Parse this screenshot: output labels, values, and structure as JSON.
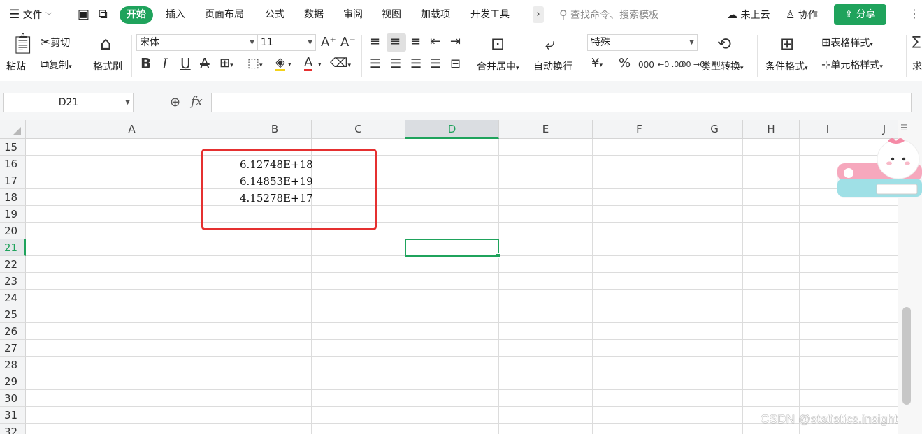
{
  "menubar": {
    "file_menu": "文件",
    "tabs": [
      {
        "label": "开始",
        "active": true
      },
      {
        "label": "插入"
      },
      {
        "label": "页面布局"
      },
      {
        "label": "公式"
      },
      {
        "label": "数据"
      },
      {
        "label": "审阅"
      },
      {
        "label": "视图"
      },
      {
        "label": "加载项"
      },
      {
        "label": "开发工具"
      }
    ],
    "more": "›",
    "search_placeholder": "查找命令、搜索模板",
    "cloud": "未上云",
    "collab": "协作",
    "share": "分享"
  },
  "ribbon": {
    "paste": "粘贴",
    "cut": "剪切",
    "copy": "复制",
    "format_painter": "格式刷",
    "font_name": "宋体",
    "font_size": "11",
    "number_format": "特殊",
    "merge_center": "合并居中",
    "wrap_text": "自动换行",
    "type_convert": "类型转换",
    "conditional_format": "条件格式",
    "table_style": "表格样式",
    "cell_style": "单元格样式",
    "sum": "求",
    "percent": "%",
    "thousands": "000",
    "dec_inc": "←0 .00",
    "dec_dec": ".00 →0",
    "currency": "¥"
  },
  "formula_bar": {
    "name_box": "D21",
    "fx": "fx",
    "value": ""
  },
  "sheet": {
    "columns": [
      "A",
      "B",
      "C",
      "D",
      "E",
      "F",
      "G",
      "H",
      "I",
      "J"
    ],
    "active_column": "D",
    "rows": [
      "15",
      "16",
      "17",
      "18",
      "19",
      "20",
      "21",
      "22",
      "23",
      "24",
      "25",
      "26",
      "27",
      "28",
      "29",
      "30",
      "31",
      "32"
    ],
    "active_row": "21",
    "cells": {
      "B16": "6.12748E+18",
      "B17": "6.14853E+19",
      "B18": "4.15278E+17"
    }
  },
  "colors": {
    "accent": "#1fa35c",
    "highlight_box": "#e53030"
  },
  "watermark": "CSDN @statistics.insight"
}
